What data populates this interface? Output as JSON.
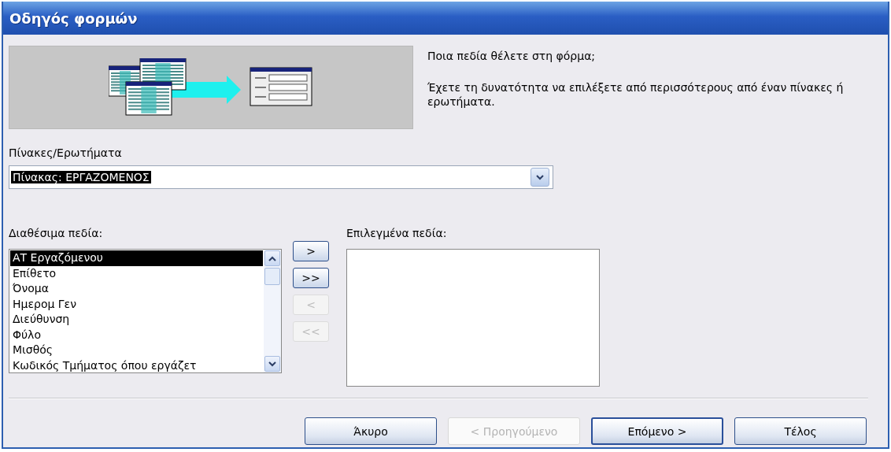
{
  "window": {
    "title": "Οδηγός φορμών"
  },
  "prompt": "Ποια πεδία θέλετε στη φόρμα;",
  "hint": "Έχετε τη δυνατότητα να επιλέξετε από περισσότερους από έναν πίνακες ή ερωτήματα.",
  "source": {
    "label": "Πίνακες/Ερωτήματα",
    "value": "Πίνακας: ΕΡΓΑΖΟΜΕΝΟΣ",
    "highlighted": true
  },
  "available": {
    "label": "Διαθέσιμα πεδία:",
    "items": [
      {
        "text": "ΑΤ Εργαζόμενου",
        "selected": true
      },
      {
        "text": "Επίθετο",
        "selected": false
      },
      {
        "text": "Όνομα",
        "selected": false
      },
      {
        "text": "Ημερομ Γεν",
        "selected": false
      },
      {
        "text": "Διεύθυνση",
        "selected": false
      },
      {
        "text": "Φύλο",
        "selected": false
      },
      {
        "text": "Μισθός",
        "selected": false
      },
      {
        "text": "Κωδικός Τμήματος όπου εργάζετ",
        "selected": false
      }
    ]
  },
  "move_buttons": [
    {
      "label": ">",
      "disabled": false
    },
    {
      "label": ">>",
      "disabled": false
    },
    {
      "label": "<",
      "disabled": true
    },
    {
      "label": "<<",
      "disabled": true
    }
  ],
  "chosen": {
    "label": "Επιλεγμένα πεδία:"
  },
  "buttons": [
    {
      "label": "Άκυρο",
      "disabled": false,
      "default": false
    },
    {
      "label": "< Προηγούμενο",
      "disabled": true,
      "default": false
    },
    {
      "label": "Επόμενο >",
      "disabled": false,
      "default": true
    },
    {
      "label": "Τέλος",
      "disabled": false,
      "default": false
    }
  ]
}
